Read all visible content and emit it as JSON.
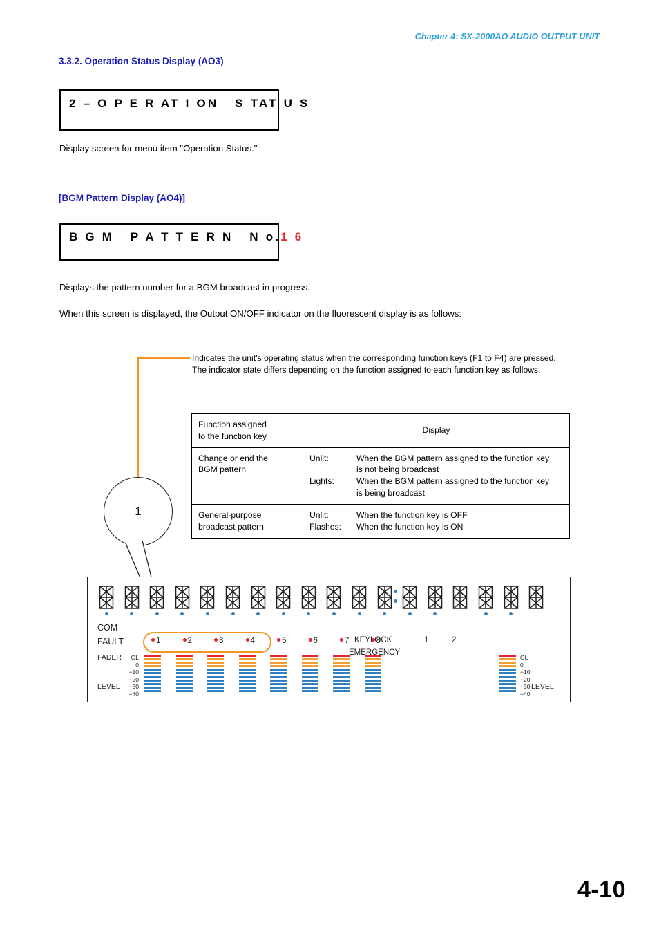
{
  "header": {
    "chapter": "Chapter 4:  SX-2000AO AUDIO OUTPUT UNIT"
  },
  "sections": {
    "operation_status": {
      "heading": "3.3.2. Operation Status Display (AO3)",
      "lcd_text": "2 – O P E R AT I ON   S TAT U S",
      "description": "Display screen for menu item \"Operation Status.\""
    },
    "bgm_pattern": {
      "heading": "[BGM Pattern Display (AO4)]",
      "lcd_prefix": "B G M   P A T T E R N   N o.",
      "lcd_value": "1 6",
      "lcd_value_color": "#e8232a",
      "description1": "Displays the pattern number for a BGM broadcast in progress.",
      "description2": "When this screen is displayed, the Output ON/OFF indicator on the fluorescent display is as follows:"
    }
  },
  "callout": {
    "number": "1",
    "line1": "Indicates the unit's operating status when the corresponding function keys (F1 to F4)",
    "line2": "are pressed.",
    "line3": "The indicator state differs depending on the function assigned to each function key as",
    "line4": "follows.",
    "leader_color": "#f59324"
  },
  "spec_table": {
    "header": {
      "col1": "Function assigned\nto the function key",
      "col2": "Display"
    },
    "rows": [
      {
        "function": "Change or end the\nBGM pattern",
        "display": [
          {
            "state": "Unlit:",
            "text": "When the BGM pattern assigned to the function key\nis not being broadcast"
          },
          {
            "state": "Lights:",
            "text": "When the BGM pattern assigned to the function key\nis being broadcast"
          }
        ]
      },
      {
        "function": "General-purpose\nbroadcast pattern",
        "display": [
          {
            "state": "Unlit:",
            "text": "When the function key is OFF"
          },
          {
            "state": "Flashes:",
            "text": "When the function key is ON"
          }
        ]
      }
    ]
  },
  "panel": {
    "segment_display": {
      "char_count": 18,
      "colon_after_index": 11,
      "dot_color": "#2f7fc1",
      "dots_present": [
        true,
        true,
        true,
        true,
        true,
        true,
        true,
        true,
        true,
        true,
        true,
        true,
        true,
        true,
        false,
        true,
        true,
        false
      ]
    },
    "labels": {
      "com": "COM",
      "fault": "FAULT",
      "fader": "FADER",
      "level": "LEVEL",
      "keylock": "KEYLOCK",
      "emergency": "EMERGENCY",
      "num1": "1",
      "num2": "2",
      "level_right": "LEVEL"
    },
    "indicators": [
      "1",
      "2",
      "3",
      "4",
      "5",
      "6",
      "7",
      "8"
    ],
    "indicator_color": "#e8232a",
    "highlight": {
      "covers": [
        "1",
        "2",
        "3",
        "4"
      ],
      "color": "#f59324"
    },
    "meter_scale": [
      "OL",
      "0",
      "−10",
      "−20",
      "−30",
      "−40"
    ],
    "meter_segments": {
      "red": 1,
      "orange": 3,
      "blue": 7,
      "red_color": "#e8232a",
      "orange_color": "#f0a02e",
      "blue_color": "#2f7fc1"
    },
    "meter_count_left": 8,
    "meter_count_right": 1
  },
  "footer": {
    "page": "4-10"
  }
}
